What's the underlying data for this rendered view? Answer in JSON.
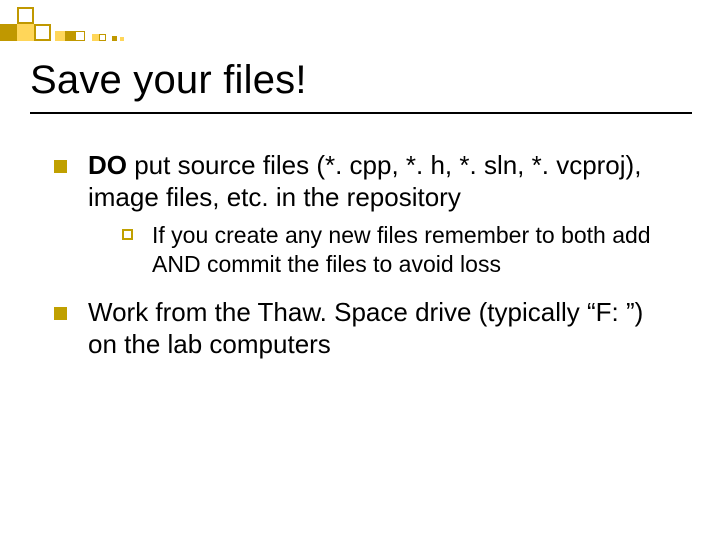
{
  "title": "Save your files!",
  "items": [
    {
      "bold": "DO",
      "rest": " put source files (*. cpp, *. h, *. sln, *. vcproj), image files, etc. in the repository",
      "sub": {
        "lead": "If",
        "rest": " you create any new files remember to both add AND commit the files to avoid loss"
      }
    },
    {
      "bold": "",
      "rest": "Work from the Thaw. Space drive (typically “F: ”) on the lab computers",
      "sub": null
    }
  ]
}
